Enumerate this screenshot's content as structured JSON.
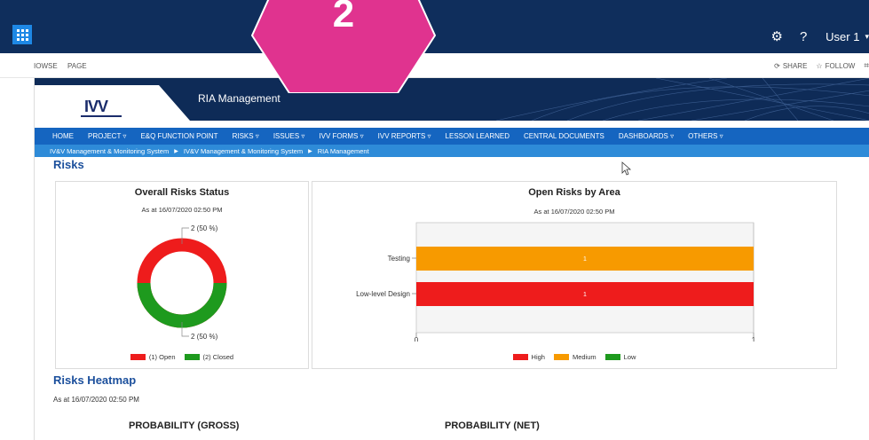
{
  "suitebar": {
    "user_label": "User 1",
    "settings_icon": "gear-icon",
    "help_label": "?",
    "app_launcher_icon": "waffle-icon"
  },
  "ribbon": {
    "browse_label": "IOWSE",
    "page_label": "PAGE",
    "share_label": "SHARE",
    "follow_label": "FOLLOW"
  },
  "site": {
    "logo_text": "IVV",
    "title": "RIA Management"
  },
  "nav": {
    "items": [
      {
        "label": "HOME"
      },
      {
        "label": "PROJECT ▿"
      },
      {
        "label": "E&Q FUNCTION POINT"
      },
      {
        "label": "RISKS ▿"
      },
      {
        "label": "ISSUES ▿"
      },
      {
        "label": "IVV FORMS ▿"
      },
      {
        "label": "IVV REPORTS ▿"
      },
      {
        "label": "LESSON LEARNED"
      },
      {
        "label": "CENTRAL DOCUMENTS"
      },
      {
        "label": "DASHBOARDS ▿"
      },
      {
        "label": "OTHERS ▿"
      }
    ]
  },
  "breadcrumb": {
    "items": [
      "IV&V Management & Monitoring System",
      "IV&V Management & Monitoring System",
      "RIA Management"
    ]
  },
  "page": {
    "heading": "Risks",
    "heatmap_heading": "Risks Heatmap",
    "heatmap_asat": "As at 16/07/2020 02:50 PM",
    "prob_gross": "PROBABILITY (GROSS)",
    "prob_net": "PROBABILITY (NET)"
  },
  "overall_panel": {
    "title": "Overall Risks Status",
    "asat": "As at 16/07/2020 02:50 PM",
    "label_top": "2 (50 %)",
    "label_bottom": "2 (50 %)",
    "legend_open": "(1) Open",
    "legend_closed": "(2) Closed"
  },
  "area_panel": {
    "title": "Open Risks by Area",
    "asat": "As at 16/07/2020 02:50 PM",
    "cat_testing": "Testing",
    "cat_lowlevel": "Low-level Design",
    "val_testing": "1",
    "val_lowlevel": "1",
    "tick_0": "0",
    "tick_1": "1",
    "legend_high": "High",
    "legend_medium": "Medium",
    "legend_low": "Low"
  },
  "badge": {
    "number": "2",
    "color": "#e0338f"
  },
  "colors": {
    "open": "#ee1c1c",
    "closed": "#1e9a1e",
    "medium": "#f79a00",
    "nav": "#1565c0"
  },
  "chart_data": [
    {
      "type": "pie",
      "title": "Overall Risks Status",
      "subtitle": "As at 16/07/2020 02:50 PM",
      "categories": [
        "(1) Open",
        "(2) Closed"
      ],
      "values": [
        2,
        2
      ],
      "percentages": [
        50,
        50
      ],
      "donut": true,
      "legend": "bottom"
    },
    {
      "type": "bar",
      "orientation": "horizontal",
      "title": "Open Risks by Area",
      "subtitle": "As at 16/07/2020 02:50 PM",
      "categories": [
        "Testing",
        "Low-level Design"
      ],
      "series": [
        {
          "name": "High",
          "values": [
            0,
            1
          ]
        },
        {
          "name": "Medium",
          "values": [
            1,
            0
          ]
        },
        {
          "name": "Low",
          "values": [
            0,
            0
          ]
        }
      ],
      "xlim": [
        0,
        1
      ],
      "legend": "bottom"
    }
  ]
}
